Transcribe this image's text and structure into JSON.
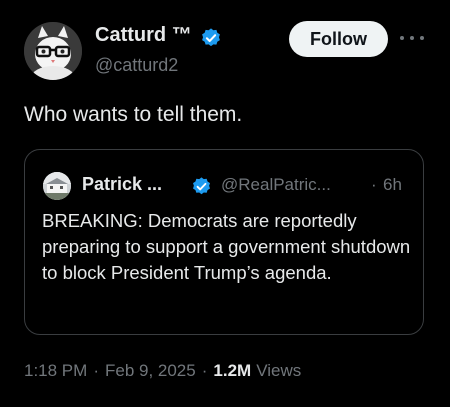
{
  "author": {
    "name": "Catturd ™",
    "handle": "@catturd2",
    "avatar_icon": "cat-with-glasses-avatar",
    "verified": true
  },
  "follow_button_label": "Follow",
  "more_icon": "more-horizontal-icon",
  "tweet_text": "Who wants to tell them.",
  "quoted_post": {
    "author_name": "Patrick ...",
    "author_handle": "@RealPatric...",
    "separator": "·",
    "time": "6h",
    "verified": true,
    "avatar_icon": "house-photo-avatar",
    "text": "BREAKING: Democrats are reportedly preparing to support a government shutdown to block President Trump’s agenda."
  },
  "meta": {
    "time": "1:18 PM",
    "separator": "·",
    "date": "Feb 9, 2025",
    "views_count": "1.2M",
    "views_label": "Views"
  },
  "colors": {
    "background": "#000000",
    "primary_text": "#e7e9ea",
    "secondary_text": "#71767b",
    "verified_blue": "#1d9bf0",
    "follow_bg": "#eff3f4",
    "card_border": "#3a3d40"
  }
}
